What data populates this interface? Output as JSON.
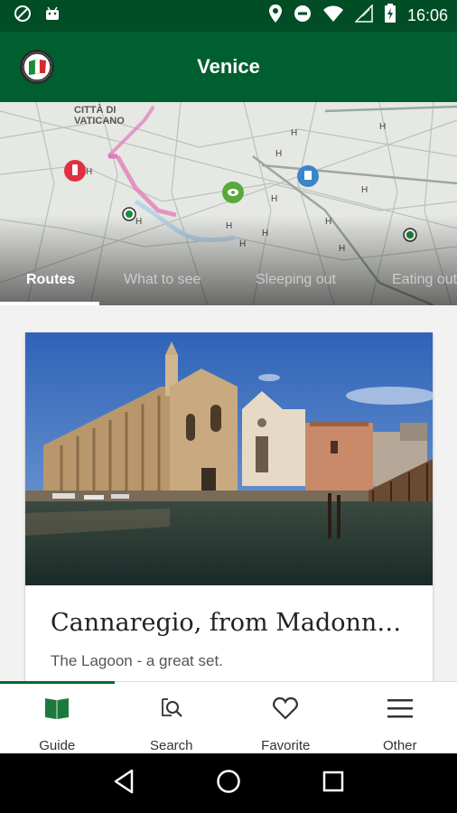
{
  "status_bar": {
    "time": "16:06",
    "icons": [
      "no-sim-icon",
      "android-icon",
      "location-icon",
      "do-not-disturb-icon",
      "wifi-icon",
      "signal-icon",
      "battery-icon"
    ]
  },
  "app_bar": {
    "title": "Venice",
    "logo": "italy-flag-logo"
  },
  "map": {
    "label_top": "CITTÀ DI\nVATICANO",
    "markers": [
      "restaurant-marker",
      "sight-marker",
      "hotel-marker",
      "routes-marker"
    ]
  },
  "tabs": [
    {
      "label": "Routes",
      "active": true
    },
    {
      "label": "What to see",
      "active": false
    },
    {
      "label": "Sleeping out",
      "active": false
    },
    {
      "label": "Eating out",
      "active": false
    }
  ],
  "card": {
    "title": "Cannaregio, from Madonna...",
    "subtitle": "The Lagoon - a great set."
  },
  "bottom_nav": [
    {
      "label": "Guide",
      "icon": "book-icon",
      "active": true
    },
    {
      "label": "Search",
      "icon": "search-icon",
      "active": false
    },
    {
      "label": "Favorite",
      "icon": "heart-icon",
      "active": false
    },
    {
      "label": "Other",
      "icon": "menu-icon",
      "active": false
    }
  ],
  "colors": {
    "primary": "#005f30",
    "primary_dark": "#004d26",
    "accent": "#006b35"
  }
}
